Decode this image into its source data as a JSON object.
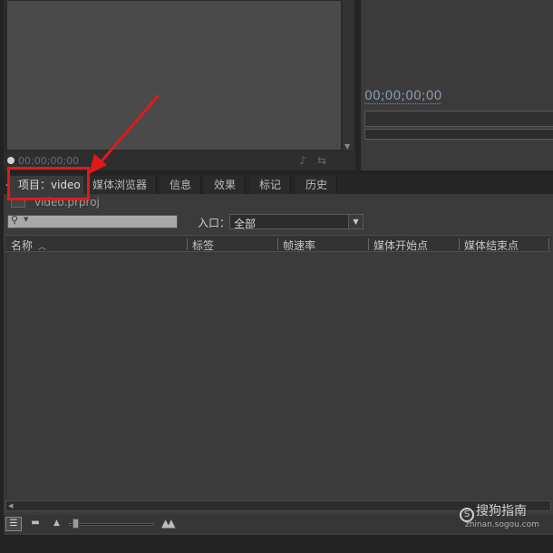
{
  "source_monitor": {
    "timecode": "00;00;00;00"
  },
  "program_monitor": {
    "timecode": "00;00;00;00"
  },
  "project_panel": {
    "tabs": [
      {
        "label": "项目：video",
        "close": "×",
        "active": true
      },
      {
        "label": "媒体浏览器",
        "active": false
      },
      {
        "label": "信息",
        "active": false
      },
      {
        "label": "效果",
        "active": false
      },
      {
        "label": "标记",
        "active": false
      },
      {
        "label": "历史",
        "active": false
      }
    ],
    "project_file": "video.prproj",
    "search": {
      "value": "",
      "placeholder": ""
    },
    "in_point": {
      "label": "入口：",
      "value": "全部"
    },
    "columns": [
      "名称",
      "标签",
      "帧速率",
      "媒体开始点",
      "媒体结束点"
    ]
  },
  "watermark": {
    "logo_text": "搜狗指南",
    "logo_mark": "S",
    "url": "zhinan.sogou.com"
  },
  "colors": {
    "highlight": "#e3181b"
  }
}
